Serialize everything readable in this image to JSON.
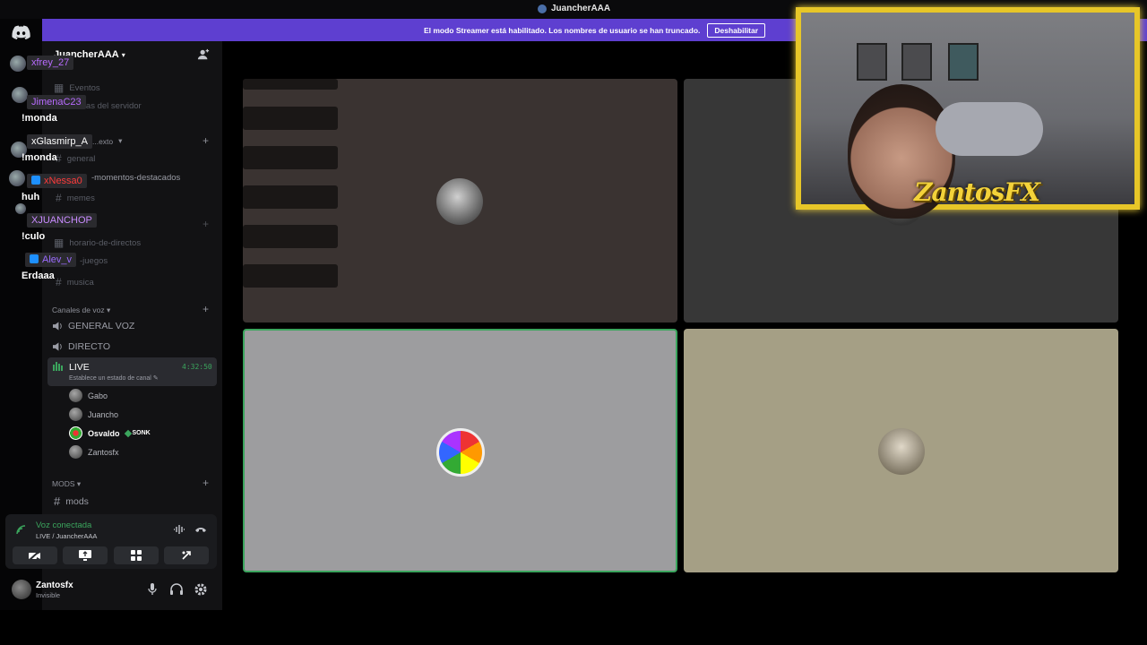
{
  "titlebar": {
    "title": "JuancherAAA"
  },
  "banner": {
    "text": "El modo Streamer está habilitado. Los nombres de usuario se han truncado.",
    "button": "Deshabilitar"
  },
  "server": {
    "name": "JuancherAAA"
  },
  "channels_partial": {
    "events": "Eventos",
    "server_guide": "...as del servidor",
    "text_category": "...exto",
    "general": "general",
    "highlights": "-momentos-destacados",
    "memes": "memes",
    "schedule": "horario-de-directos",
    "games": "-juegos",
    "music": "musica"
  },
  "voice_category": {
    "label": "Canales de voz"
  },
  "voice_channels": [
    {
      "name": "GENERAL VOZ"
    },
    {
      "name": "DIRECTO"
    }
  ],
  "live_channel": {
    "name": "LIVE",
    "time": "4:32:50",
    "subtitle": "Establece un estado de canal"
  },
  "voice_users": [
    {
      "name": "Gabo"
    },
    {
      "name": "Juancho"
    },
    {
      "name": "Osvaldo",
      "badge": "SONK"
    },
    {
      "name": "Zantosfx"
    }
  ],
  "mods_category": {
    "label": "MODS"
  },
  "mods_channel": {
    "name": "mods"
  },
  "voice_panel": {
    "status": "Voz conectada",
    "location": "LIVE / JuancherAAA"
  },
  "user": {
    "name": "Zantosfx",
    "status": "Invisible"
  },
  "chat": [
    {
      "user": "xfrey_27",
      "color": "#b86bff",
      "msg": ""
    },
    {
      "user": "JimenaC23",
      "color": "#b86bff",
      "msg": "!monda"
    },
    {
      "user": "xGlasmirp_A",
      "color": "#ffffff",
      "msg": "!monda"
    },
    {
      "user": "xNessa0",
      "color": "#ff3b3b",
      "msg": "huh"
    },
    {
      "user": "XJUANCHOP",
      "color": "#c98bff",
      "msg": "!culo"
    },
    {
      "user": "Alev_v",
      "color": "#9b6bff",
      "msg": "Erdaaa"
    }
  ],
  "webcam": {
    "logo": "ZantosFX"
  },
  "colors": {
    "accent": "#5e3fd0",
    "green": "#3ba55d",
    "gold": "#e7c628"
  }
}
